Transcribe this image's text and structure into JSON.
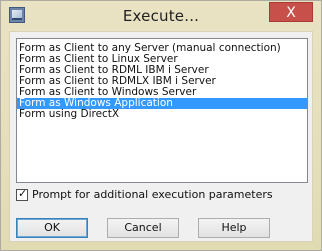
{
  "window": {
    "title": "Execute...",
    "close_label": "X"
  },
  "list": {
    "items": [
      {
        "label": "Form as Client to any Server (manual connection)",
        "selected": false
      },
      {
        "label": "Form as Client to Linux Server",
        "selected": false
      },
      {
        "label": "Form as Client to RDML IBM i Server",
        "selected": false
      },
      {
        "label": "Form as Client to RDMLX IBM i Server",
        "selected": false
      },
      {
        "label": "Form as Client to Windows Server",
        "selected": false
      },
      {
        "label": "Form as Windows Application",
        "selected": true
      },
      {
        "label": "Form using DirectX",
        "selected": false
      }
    ]
  },
  "options": {
    "prompt_label": "Prompt for additional execution parameters",
    "prompt_checked": true
  },
  "buttons": {
    "ok": "OK",
    "cancel": "Cancel",
    "help": "Help"
  },
  "colors": {
    "selection": "#3399ff",
    "close": "#c7504b"
  }
}
